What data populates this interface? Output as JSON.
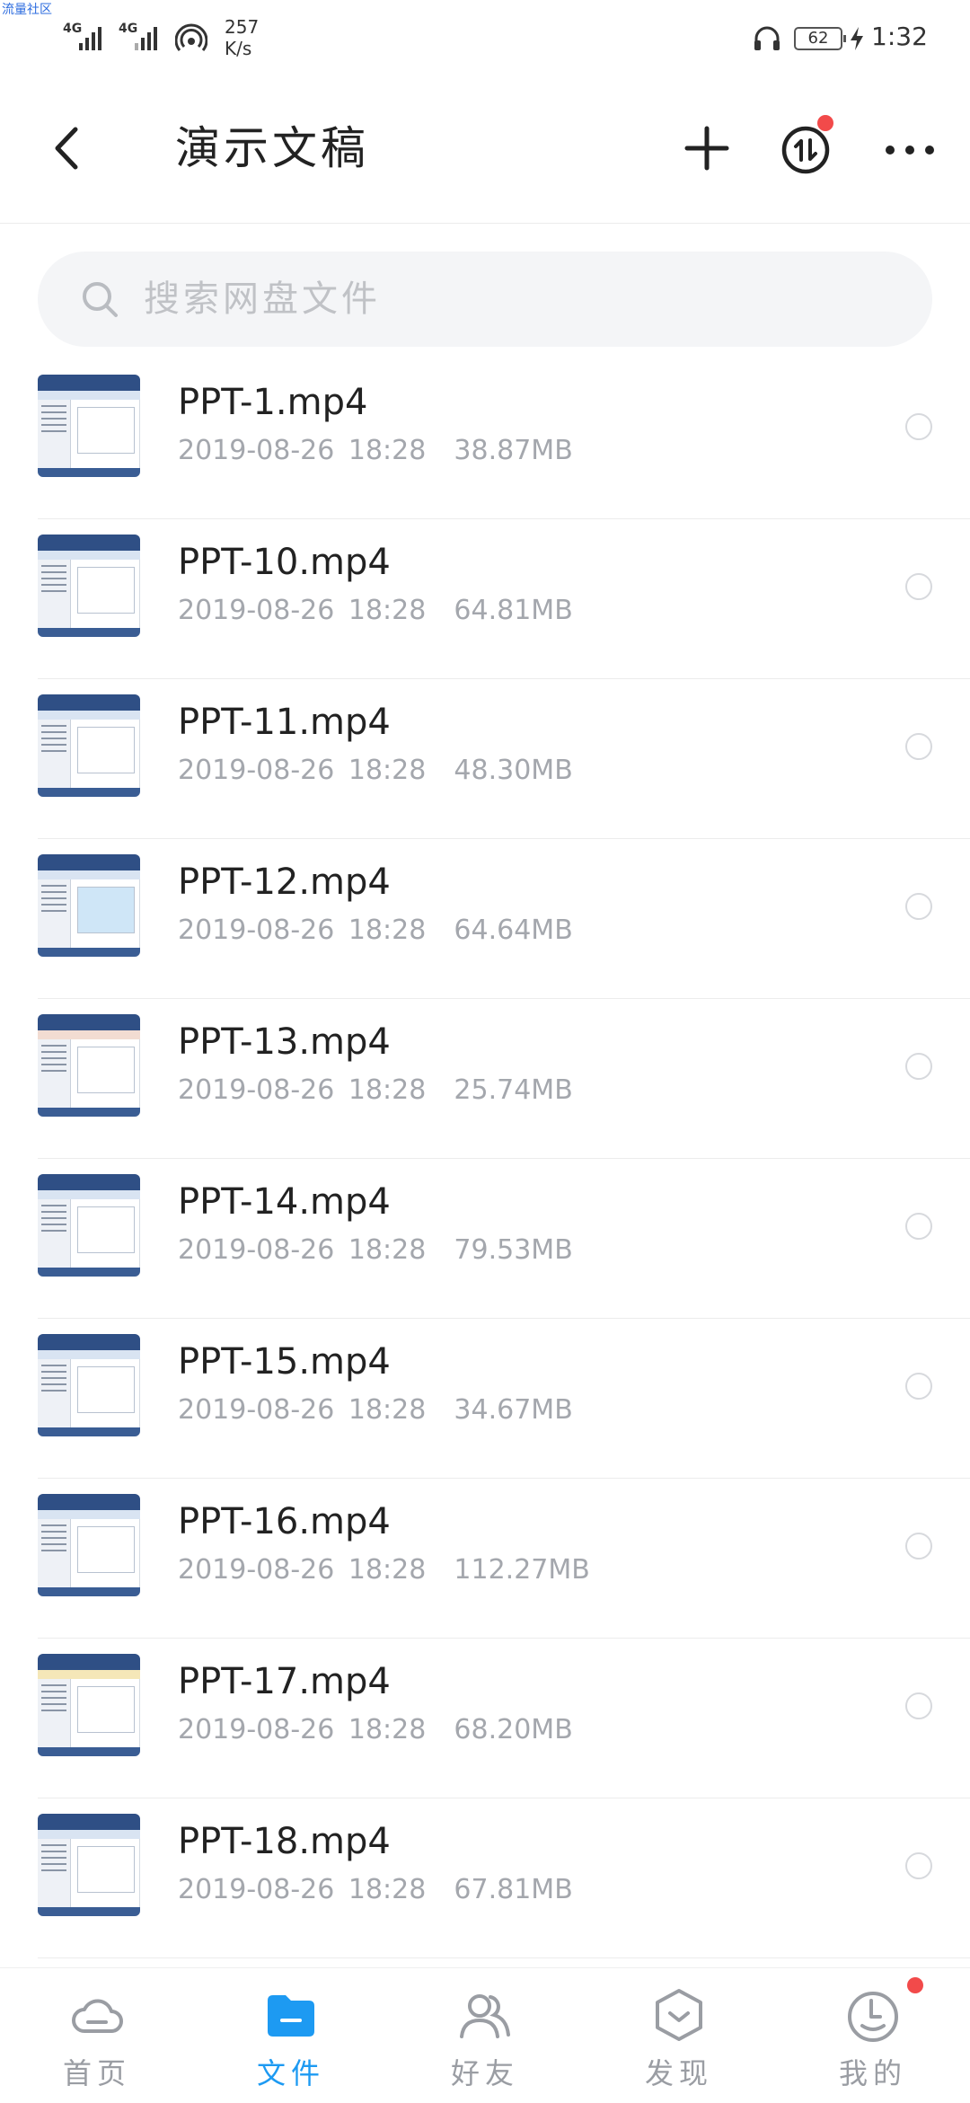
{
  "watermark": "流量社区",
  "status_bar": {
    "signal1": "4G",
    "signal2": "4G",
    "net_speed_value": "257",
    "net_speed_unit": "K/s",
    "battery": "62",
    "time": "1:32"
  },
  "header": {
    "title": "演示文稿"
  },
  "search": {
    "placeholder": "搜索网盘文件"
  },
  "files": [
    {
      "name": "PPT-1.mp4",
      "date": "2019-08-26 18:28",
      "size": "38.87MB"
    },
    {
      "name": "PPT-10.mp4",
      "date": "2019-08-26 18:28",
      "size": "64.81MB"
    },
    {
      "name": "PPT-11.mp4",
      "date": "2019-08-26 18:28",
      "size": "48.30MB"
    },
    {
      "name": "PPT-12.mp4",
      "date": "2019-08-26 18:28",
      "size": "64.64MB"
    },
    {
      "name": "PPT-13.mp4",
      "date": "2019-08-26 18:28",
      "size": "25.74MB"
    },
    {
      "name": "PPT-14.mp4",
      "date": "2019-08-26 18:28",
      "size": "79.53MB"
    },
    {
      "name": "PPT-15.mp4",
      "date": "2019-08-26 18:28",
      "size": "34.67MB"
    },
    {
      "name": "PPT-16.mp4",
      "date": "2019-08-26 18:28",
      "size": "112.27MB"
    },
    {
      "name": "PPT-17.mp4",
      "date": "2019-08-26 18:28",
      "size": "68.20MB"
    },
    {
      "name": "PPT-18.mp4",
      "date": "2019-08-26 18:28",
      "size": "67.81MB"
    }
  ],
  "nav": [
    {
      "label": "首页",
      "icon": "cloud-icon",
      "active": false
    },
    {
      "label": "文件",
      "icon": "folder-icon",
      "active": true
    },
    {
      "label": "好友",
      "icon": "friends-icon",
      "active": false
    },
    {
      "label": "发现",
      "icon": "discover-icon",
      "active": false
    },
    {
      "label": "我的",
      "icon": "profile-icon",
      "active": false
    }
  ],
  "colors": {
    "accent": "#1d9af2",
    "badge": "#f24a4a",
    "inactive": "#9a9da3",
    "text_primary": "#222222",
    "text_secondary": "#a4a7ad"
  }
}
